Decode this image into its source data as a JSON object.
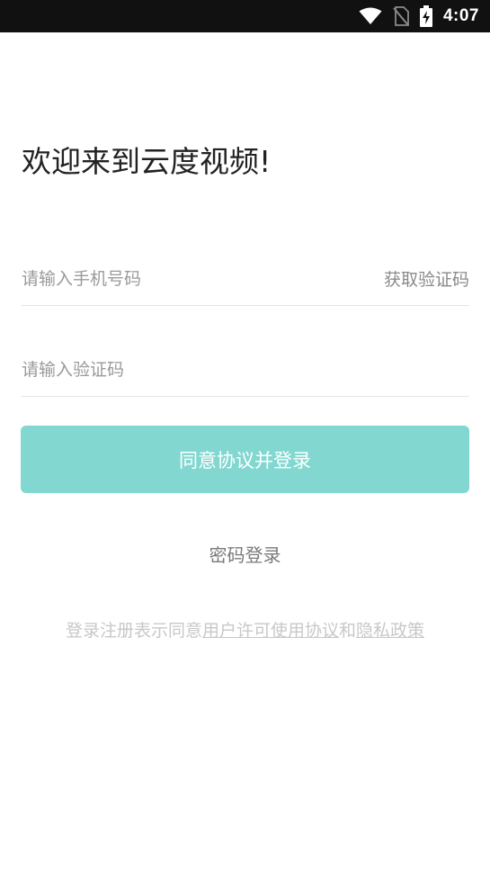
{
  "status_bar": {
    "time": "4:07",
    "icons": [
      "wifi-icon",
      "no-sim-icon",
      "battery-charging-icon"
    ]
  },
  "title": "欢迎来到云度视频!",
  "phone_field": {
    "placeholder": "请输入手机号码",
    "value": "",
    "get_code_label": "获取验证码"
  },
  "code_field": {
    "placeholder": "请输入验证码",
    "value": ""
  },
  "login_button": {
    "label": "同意协议并登录",
    "color": "#82d8d1"
  },
  "password_login_label": "密码登录",
  "agreement": {
    "prefix": "登录注册表示同意",
    "user_agreement_link": "用户许可使用协议",
    "conjunction": "和",
    "privacy_link": "隐私政策"
  }
}
